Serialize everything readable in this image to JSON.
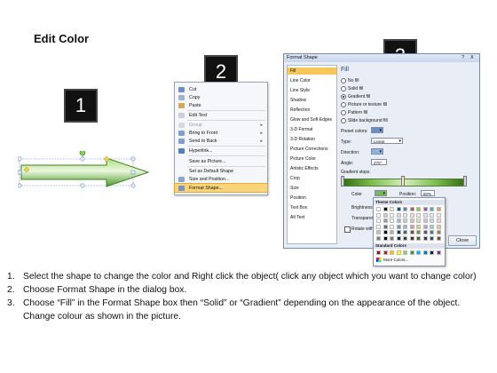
{
  "title": "Edit Color",
  "steps": {
    "one": "1",
    "two": "2",
    "three": "3"
  },
  "context_menu": {
    "items": [
      {
        "label": "Cut",
        "disabled": false,
        "submenu": false
      },
      {
        "label": "Copy",
        "disabled": false,
        "submenu": false
      },
      {
        "label": "Paste",
        "disabled": false,
        "submenu": false
      },
      {
        "label": "Edit Text",
        "disabled": false,
        "submenu": false
      },
      {
        "label": "Group",
        "disabled": true,
        "submenu": true
      },
      {
        "label": "Bring to Front",
        "disabled": false,
        "submenu": true
      },
      {
        "label": "Send to Back",
        "disabled": false,
        "submenu": true
      },
      {
        "label": "Hyperlink...",
        "disabled": false,
        "submenu": false
      },
      {
        "label": "Save as Picture...",
        "disabled": false,
        "submenu": false
      },
      {
        "label": "Set as Default Shape",
        "disabled": false,
        "submenu": false
      },
      {
        "label": "Size and Position...",
        "disabled": false,
        "submenu": false
      },
      {
        "label": "Format Shape...",
        "disabled": false,
        "submenu": false,
        "highlighted": true
      }
    ]
  },
  "dialog": {
    "title": "Format Shape",
    "help": "?",
    "close_x": "X",
    "nav": [
      "Fill",
      "Line Color",
      "Line Style",
      "Shadow",
      "Reflection",
      "Glow and Soft Edges",
      "3-D Format",
      "3-D Rotation",
      "Picture Corrections",
      "Picture Color",
      "Artistic Effects",
      "Crop",
      "Size",
      "Position",
      "Text Box",
      "Alt Text"
    ],
    "fill": {
      "header": "Fill",
      "options": [
        "No fill",
        "Solid fill",
        "Gradient fill",
        "Picture or texture fill",
        "Pattern fill",
        "Slide background fill"
      ],
      "selected": "Gradient fill",
      "preset_label": "Preset colors:",
      "type_label": "Type:",
      "type_value": "Linear",
      "direction_label": "Direction:",
      "angle_label": "Angle:",
      "angle_value": "270°",
      "stops_label": "Gradient stops",
      "color_label": "Color",
      "position_label": "Position:",
      "position_value": "60%",
      "brightness_label": "Brightness",
      "transparency_label": "Transparency",
      "rotate_label": "Rotate with shape"
    },
    "close_button": "Close"
  },
  "palette": {
    "theme_header": "Theme Colors",
    "standard_header": "Standard Colors",
    "more_colors": "More Colors...",
    "theme_top": [
      "#ffffff",
      "#000000",
      "#eeece1",
      "#1f497d",
      "#4f81bd",
      "#c0504d",
      "#9bbb59",
      "#8064a2",
      "#4bacc6",
      "#f79646"
    ],
    "standard": [
      "#c00000",
      "#ff0000",
      "#ffc000",
      "#ffff00",
      "#92d050",
      "#00b050",
      "#00b0f0",
      "#0070c0",
      "#002060",
      "#7030a0"
    ]
  },
  "instructions": [
    {
      "num": "1.",
      "text": "Select the shape to change the color and Right click the object( click any object which you want to change color)"
    },
    {
      "num": "2.",
      "text": "Choose Format Shape in the dialog box."
    },
    {
      "num": "3.",
      "text": "Choose “Fill” in the Format Shape box then “Solid” or “Gradient” depending on the appearance of the object. Change colour as shown in the picture."
    }
  ]
}
